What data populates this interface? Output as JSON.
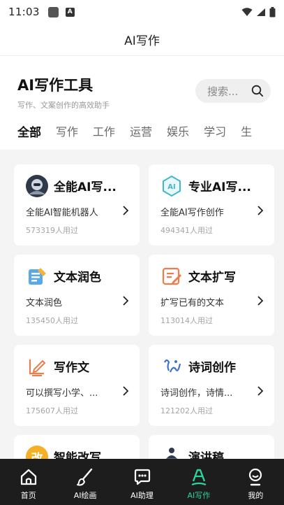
{
  "status_bar": {
    "time": "11:03",
    "notif_letter": "A"
  },
  "header": {
    "title": "AI写作"
  },
  "section": {
    "title": "AI写作工具",
    "subtitle": "写作、文案创作的高效助手",
    "search_placeholder": "搜索..."
  },
  "tabs": [
    "全部",
    "写作",
    "工作",
    "运营",
    "娱乐",
    "学习",
    "生"
  ],
  "cards": [
    {
      "title": "全能AI写...",
      "desc": "全能AI智能机器人",
      "count": "573319人用过",
      "icon": "robot-avatar-icon"
    },
    {
      "title": "专业AI写...",
      "desc": "全能AI写作创作",
      "count": "494341人用过",
      "icon": "ai-hexagon-icon"
    },
    {
      "title": "文本润色",
      "desc": "文本润色",
      "count": "135450人用过",
      "icon": "text-polish-icon"
    },
    {
      "title": "文本扩写",
      "desc": "扩写已有的文本",
      "count": "113014人用过",
      "icon": "text-expand-icon"
    },
    {
      "title": "写作文",
      "desc": "可以撰写小学、...",
      "count": "175607人用过",
      "icon": "essay-pen-icon"
    },
    {
      "title": "诗词创作",
      "desc": "诗词创作，诗情...",
      "count": "121202人用过",
      "icon": "poetry-icon"
    },
    {
      "title": "智能改写",
      "desc": "",
      "count": "",
      "icon": "rewrite-badge-icon",
      "badge": "改"
    },
    {
      "title": "演讲稿",
      "desc": "",
      "count": "",
      "icon": "speech-podium-icon"
    }
  ],
  "nav": [
    {
      "label": "首页",
      "icon": "home-icon"
    },
    {
      "label": "AI绘画",
      "icon": "brush-icon"
    },
    {
      "label": "AI助理",
      "icon": "chat-bubble-icon"
    },
    {
      "label": "AI写作",
      "icon": "pen-writing-icon",
      "active": true
    },
    {
      "label": "我的",
      "icon": "user-profile-icon"
    }
  ],
  "colors": {
    "accent": "#2fd49a",
    "nav_bg": "#1d1d1d",
    "content_bg": "#f4f4f4"
  }
}
